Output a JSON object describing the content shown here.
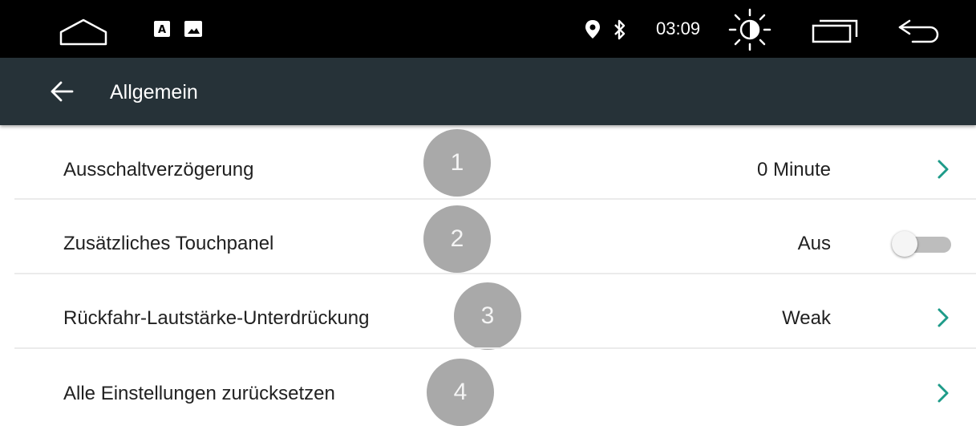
{
  "status_bar": {
    "time": "03:09",
    "icons": [
      "home-icon",
      "keyboard-a-icon",
      "image-icon",
      "location-pin-icon",
      "bluetooth-icon",
      "brightness-icon",
      "recent-apps-icon",
      "back-icon"
    ]
  },
  "app_bar": {
    "title": "Allgemein",
    "back_icon": "arrow-left-icon"
  },
  "settings": [
    {
      "label": "Ausschaltverzögerung",
      "badge": "1",
      "value": "0 Minute",
      "control": "chevron"
    },
    {
      "label": "Zusätzliches Touchpanel",
      "badge": "2",
      "value": "Aus",
      "control": "toggle",
      "toggle_on": false
    },
    {
      "label": "Rückfahr-Lautstärke-Unterdrückung",
      "badge": "3",
      "value": "Weak",
      "control": "chevron"
    },
    {
      "label": "Alle Einstellungen zurücksetzen",
      "badge": "4",
      "value": "",
      "control": "chevron"
    }
  ],
  "colors": {
    "status_bar_bg": "#000000",
    "app_bar_bg": "#263238",
    "accent_chevron": "#1e9b89",
    "badge_bg": "#a9a9a9",
    "toggle_track": "#bdbdbd"
  }
}
